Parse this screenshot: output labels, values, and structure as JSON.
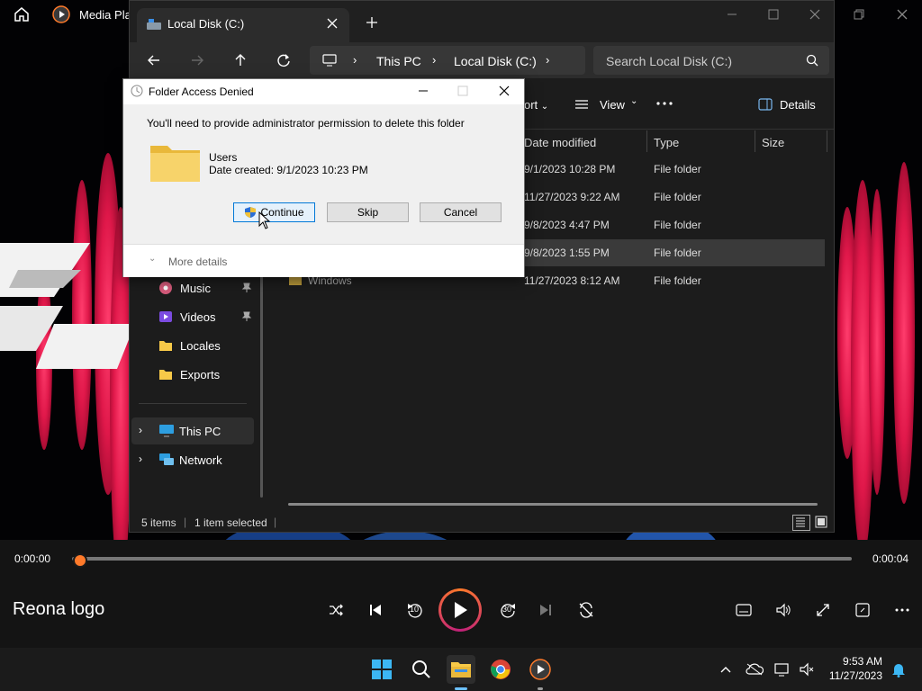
{
  "media_player": {
    "app_title": "Media Play",
    "time_current": "0:00:00",
    "time_total": "0:00:04",
    "track_title": "Reona logo",
    "progress": 0,
    "skip_back_label": "10",
    "skip_forward_label": "30"
  },
  "explorer": {
    "tab_title": "Local Disk (C:)",
    "breadcrumb": [
      "This PC",
      "Local Disk (C:)"
    ],
    "search_placeholder": "Search Local Disk (C:)",
    "toolbar": {
      "sort_label": "ort",
      "view_label": "View",
      "details_label": "Details"
    },
    "sidebar": [
      {
        "label": "Music",
        "icon": "music-icon",
        "pinned": true
      },
      {
        "label": "Videos",
        "icon": "videos-icon",
        "pinned": true
      },
      {
        "label": "Locales",
        "icon": "folder-icon",
        "pinned": false
      },
      {
        "label": "Exports",
        "icon": "folder-icon",
        "pinned": false
      },
      {
        "label": "This PC",
        "icon": "this-pc-icon",
        "expandable": true
      },
      {
        "label": "Network",
        "icon": "network-icon",
        "expandable": true
      }
    ],
    "columns": {
      "date_modified": "Date modified",
      "type": "Type",
      "size": "Size"
    },
    "rows": [
      {
        "name": "",
        "date": "9/1/2023 10:28 PM",
        "type": "File folder"
      },
      {
        "name": "",
        "date": "11/27/2023 9:22 AM",
        "type": "File folder"
      },
      {
        "name": "",
        "date": "9/8/2023 4:47 PM",
        "type": "File folder"
      },
      {
        "name": "",
        "date": "9/8/2023 1:55 PM",
        "type": "File folder",
        "selected": true
      },
      {
        "name": "Windows",
        "date": "11/27/2023 8:12 AM",
        "type": "File folder"
      }
    ],
    "status": {
      "items": "5 items",
      "selected": "1 item selected"
    }
  },
  "dialog": {
    "title": "Folder Access Denied",
    "message": "You'll need to provide administrator permission to delete this folder",
    "folder_name": "Users",
    "date_created": "Date created: 9/1/2023 10:23 PM",
    "buttons": {
      "continue": "Continue",
      "skip": "Skip",
      "cancel": "Cancel"
    },
    "more_details": "More details"
  },
  "taskbar": {
    "clock_time": "9:53 AM",
    "clock_date": "11/27/2023"
  },
  "colors": {
    "accent_orange": "#ff7a2a",
    "folder_yellow": "#f7c948",
    "explorer_bg": "#1c1c1c",
    "taskbar_bg": "#1b1b1b"
  }
}
